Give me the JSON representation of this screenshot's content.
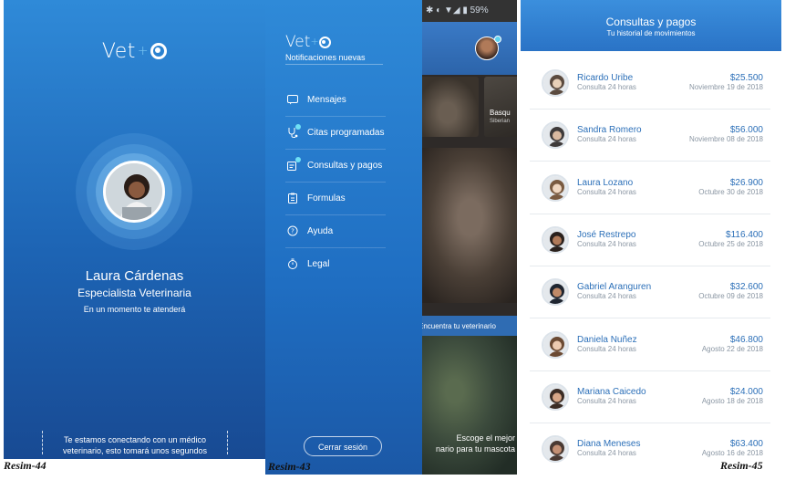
{
  "screen_connecting": {
    "logo_text": "Vet",
    "doctor_name": "Laura Cárdenas",
    "specialty": "Especialista Veterinaria",
    "wait_message": "En un momento te atenderá",
    "connecting_message": "Te estamos conectando con un médico veterinario, esto tomará unos segundos",
    "caption": "Resim-44"
  },
  "screen_menu": {
    "logo_text": "Vet",
    "notifications": "Notificaciones nuevas",
    "menu": [
      {
        "label": "Mensajes",
        "icon": "chat-icon"
      },
      {
        "label": "Citas programadas",
        "icon": "stethoscope-icon"
      },
      {
        "label": "Consultas y pagos",
        "icon": "payments-icon"
      },
      {
        "label": "Formulas",
        "icon": "clipboard-icon"
      },
      {
        "label": "Ayuda",
        "icon": "help-icon"
      },
      {
        "label": "Legal",
        "icon": "stopwatch-icon"
      }
    ],
    "logout_label": "Cerrar sesión",
    "status_battery": "59%",
    "background_app": {
      "card_title": "Basqu",
      "card_subtitle": "Siberian",
      "find_vet": "Encuentra tu veterinario",
      "banner_line1": "Escoge el mejor",
      "banner_line2": "nario para tu mascota"
    },
    "caption": "Resim-43"
  },
  "screen_payments": {
    "title": "Consultas y pagos",
    "subtitle": "Tu historial de movimientos",
    "rows": [
      {
        "name": "Ricardo Uribe",
        "type": "Consulta 24 horas",
        "amount": "$25.500",
        "date": "Noviembre 19 de 2018"
      },
      {
        "name": "Sandra Romero",
        "type": "Consulta 24 horas",
        "amount": "$56.000",
        "date": "Noviembre 08 de 2018"
      },
      {
        "name": "Laura Lozano",
        "type": "Consulta 24 horas",
        "amount": "$26.900",
        "date": "Octubre 30 de 2018"
      },
      {
        "name": "José Restrepo",
        "type": "Consulta 24 horas",
        "amount": "$116.400",
        "date": "Octubre 25 de 2018"
      },
      {
        "name": "Gabriel Aranguren",
        "type": "Consulta 24 horas",
        "amount": "$32.600",
        "date": "Octubre 09 de 2018"
      },
      {
        "name": "Daniela Nuñez",
        "type": "Consulta 24 horas",
        "amount": "$46.800",
        "date": "Agosto 22 de 2018"
      },
      {
        "name": "Mariana Caicedo",
        "type": "Consulta 24 horas",
        "amount": "$24.000",
        "date": "Agosto 18 de 2018"
      },
      {
        "name": "Diana Meneses",
        "type": "Consulta 24 horas",
        "amount": "$63.400",
        "date": "Agosto 16 de 2018"
      }
    ],
    "caption": "Resim-45"
  },
  "colors": {
    "brand_blue": "#2a73c6",
    "accent_cyan": "#6fe0f5",
    "name_blue": "#2b6fb8"
  }
}
